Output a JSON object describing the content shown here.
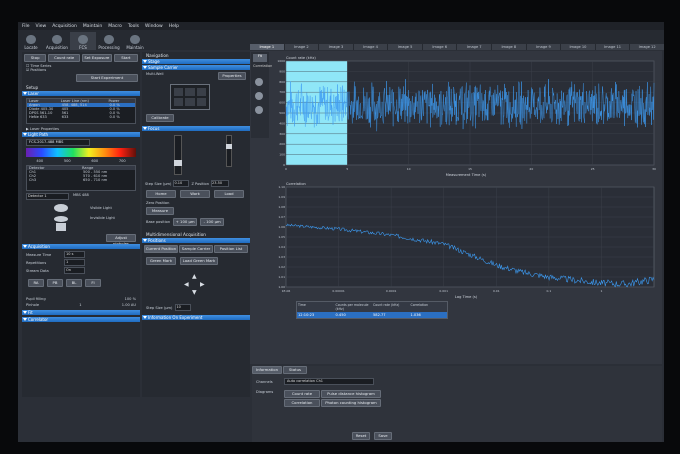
{
  "menu": [
    "File",
    "View",
    "Acquisition",
    "Maintain",
    "Macro",
    "Tools",
    "Window",
    "Help"
  ],
  "toolbar": [
    {
      "label": "Locate",
      "active": false
    },
    {
      "label": "Acquisition",
      "active": false
    },
    {
      "label": "FCS",
      "active": true
    },
    {
      "label": "Processing",
      "active": false
    },
    {
      "label": "Maintain",
      "active": false
    }
  ],
  "tabs": [
    "Image 1",
    "Image 2",
    "Image 3",
    "Image 4",
    "Image 5",
    "Image 6",
    "Image 7",
    "Image 8",
    "Image 9",
    "Image 10",
    "Image 11",
    "Image 12"
  ],
  "left": {
    "buttons_row1": [
      "Stop",
      "Count rate",
      "Set Exposure",
      "Start"
    ],
    "time_series": "Time Series",
    "positions": "Positions",
    "start_experiment": "Start Experiment",
    "setup_header": "Setup",
    "lasers_header": "Laser",
    "lasers_columns": [
      "Laser",
      "Laser Line (nm)",
      "Power"
    ],
    "lasers": [
      [
        "Argon",
        "458, 488, 514",
        "0.0 %"
      ],
      [
        "Diode 405-30",
        "405",
        "0.0 %"
      ],
      [
        "DPSS 561-10",
        "561",
        "0.0 %"
      ],
      [
        "HeNe 633",
        "633",
        "0.0 %"
      ]
    ],
    "laser_properties": "Laser Properties",
    "light_path_header": "Light Path",
    "light_path_channel": "FCS-2017-488 MBS",
    "spectrum_ticks": [
      "400",
      "500",
      "600",
      "700"
    ],
    "beam_columns": [
      "Detector",
      "Range"
    ],
    "beam_rows": [
      [
        "Ch1",
        "500 - 550 nm"
      ],
      [
        "Ch2",
        "570 - 610 nm"
      ],
      [
        "Ch3",
        "650 - 710 nm"
      ]
    ],
    "detector_sel": "Detector 1",
    "mbs_label": "MBS 488",
    "visible_light": "Visible Light",
    "invisible_light": "Invisible Light",
    "adjust_pinhole": "Adjust pinholes",
    "acquisition_header": "Acquisition",
    "acq_fields": [
      [
        "Measure Time",
        "10 s"
      ],
      [
        "Repetitions",
        "1"
      ],
      [
        "Stream Data",
        "On"
      ]
    ],
    "acq_buttons": [
      "RA",
      "PB",
      "BL",
      "FI"
    ],
    "pupil_label": "Pupil filling",
    "pupil_value": "100 %",
    "pinhole_label": "Pinhole",
    "pinhole_value": "1",
    "pinhole_unit": "1.00 AU",
    "fit_header": "Fit",
    "correlator_header": "Correlator"
  },
  "middle": {
    "navigation": "Navigation",
    "stage_header": "Stage",
    "sample_carrier": "Sample Carrier",
    "stage_value": "Multi-Well",
    "properties_btn": "Properties",
    "calibrate_btn": "Calibrate",
    "focus_header": "Focus",
    "step_size": "Step Size (µm)",
    "step_value": "0.10",
    "z_position": "Z Position",
    "z_value": "23.50",
    "home_btn": "Home",
    "work_btn": "Work",
    "load_btn": "Load",
    "zero_position": "Zero Position",
    "measure_btn": "Measure",
    "base_position": "Base position",
    "base_vals": [
      "+ 100 µm",
      "- 100 µm"
    ],
    "multidim": "Multidimensional Acquisition",
    "positions_header": "Positions",
    "pos_tabs": [
      "Current Position",
      "Sample Carrier",
      "Position List"
    ],
    "green_mark": "Green Mark",
    "load_green": "Load Green Mark",
    "stage_step": "Step Size (µm)",
    "stage_step_value": "10",
    "info_header": "Information On Experiment"
  },
  "plot_side": {
    "label1": "Fit",
    "label2": "Correlation"
  },
  "chart_data": [
    {
      "type": "line",
      "title": "",
      "ylabel": "Count rate (kHz)",
      "xlabel": "Measurement Time (s)",
      "xlim": [
        0,
        30
      ],
      "ylim": [
        0,
        1000
      ],
      "x_ticks": [
        "0",
        "5",
        "10",
        "15",
        "20",
        "25",
        "30"
      ],
      "y_ticks": [
        "0",
        "100",
        "200",
        "300",
        "400",
        "500",
        "600",
        "700",
        "800",
        "900",
        "1000"
      ],
      "highlight_x": [
        0,
        5
      ],
      "series": [
        {
          "mean": 580,
          "amplitude": 260,
          "color": "#3d9bf2"
        }
      ]
    },
    {
      "type": "line",
      "title": "",
      "ylabel": "Correlation",
      "xlabel": "Lag Time (s)",
      "xscale": "log",
      "xlim": [
        1e-06,
        10
      ],
      "ylim": [
        1.0,
        1.1
      ],
      "x_ticks": [
        "1E-06",
        "0.00001",
        "0.0001",
        "0.001",
        "0.01",
        "0.1",
        "1"
      ],
      "y_ticks": [
        "1.00",
        "1.01",
        "1.02",
        "1.03",
        "1.04",
        "1.05",
        "1.06",
        "1.07",
        "1.08",
        "1.09",
        "1.10"
      ],
      "series": [
        {
          "x": [
            1e-06,
            1e-05,
            0.0001,
            0.001,
            0.003,
            0.01,
            0.03,
            0.1,
            0.3,
            1,
            3,
            10
          ],
          "y": [
            1.062,
            1.058,
            1.052,
            1.043,
            1.033,
            1.022,
            1.015,
            1.01,
            1.007,
            1.004,
            1.003,
            1.008
          ],
          "color": "#3d9bf2"
        }
      ]
    }
  ],
  "results_table": {
    "columns": [
      "Time",
      "Counts per molecule (kHz)",
      "Count rate (kHz)",
      "Correlation"
    ],
    "row": [
      "12:10:23",
      "0.450",
      "582.77",
      "1.036"
    ]
  },
  "bottom": {
    "tabs": [
      "Information",
      "Status"
    ],
    "channels_label": "Channels",
    "channels_value": "Auto correlation Ch1",
    "diagrams_label": "Diagrams",
    "diag_buttons": [
      "Count rate",
      "Correlation"
    ],
    "diag_right": [
      "Pulse distance histogram",
      "Photon counting histogram"
    ],
    "reset_btn": "Reset",
    "save_btn": "Save"
  },
  "colors": {
    "accent": "#1f6bc0",
    "trace": "#3d9bf2",
    "highlight": "#8fe6f7"
  }
}
